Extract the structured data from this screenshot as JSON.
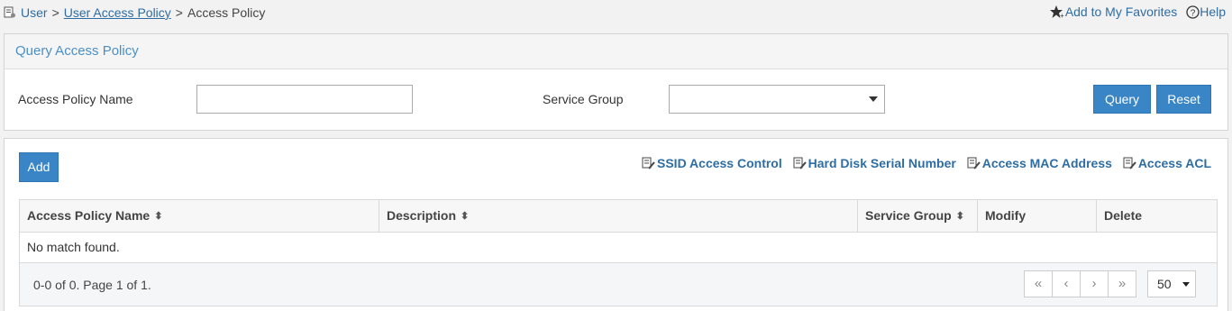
{
  "breadcrumb": {
    "items": [
      "User",
      "User Access Policy",
      "Access Policy"
    ],
    "separator": ">"
  },
  "header_links": {
    "favorites": "Add to My Favorites",
    "help": "Help"
  },
  "query_panel": {
    "title": "Query Access Policy",
    "policy_name_label": "Access Policy Name",
    "policy_name_value": "",
    "service_group_label": "Service Group",
    "service_group_value": "",
    "query_button": "Query",
    "reset_button": "Reset"
  },
  "list_panel": {
    "add_button": "Add",
    "links": [
      "SSID Access Control",
      "Hard Disk Serial Number",
      "Access MAC Address",
      "Access ACL"
    ],
    "table": {
      "columns": [
        "Access Policy Name",
        "Description",
        "Service Group",
        "Modify",
        "Delete"
      ],
      "empty_message": "No match found.",
      "pagination_info": "0-0 of 0. Page 1 of 1.",
      "pager_buttons": [
        "«",
        "‹",
        "›",
        "»"
      ],
      "page_size": "50"
    }
  },
  "colors": {
    "accent": "#3a85c6",
    "link": "#2e6da4",
    "panel_title": "#4a90c8"
  }
}
